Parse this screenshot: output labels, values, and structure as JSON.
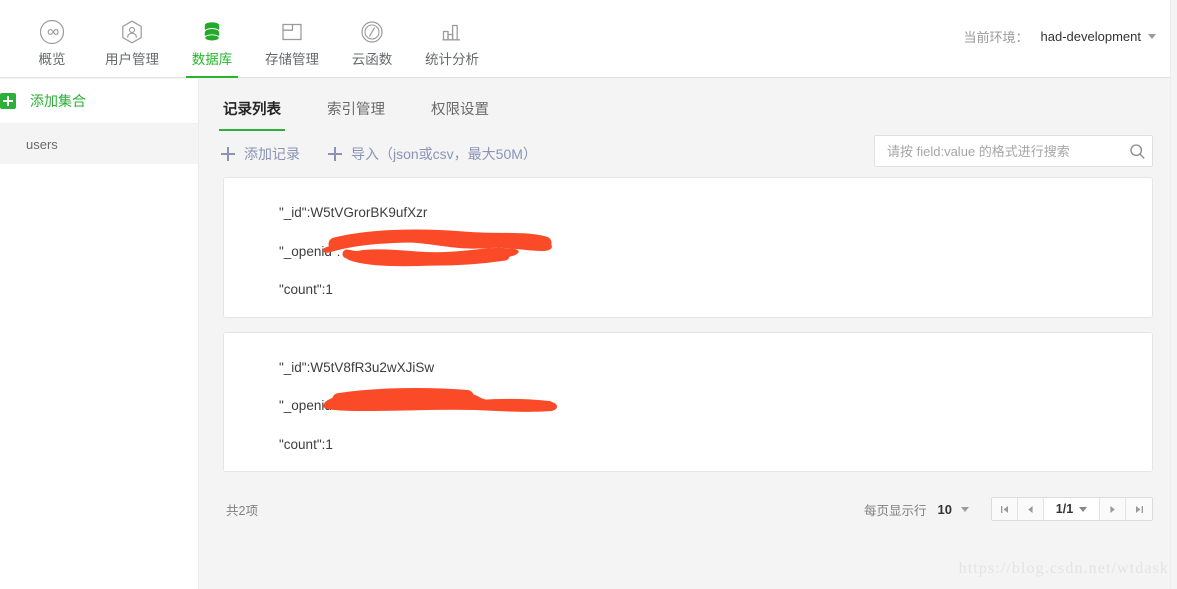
{
  "topnav": {
    "items": [
      {
        "label": "概览",
        "icon": "infinity-circle-icon",
        "active": false
      },
      {
        "label": "用户管理",
        "icon": "user-hexagon-icon",
        "active": false
      },
      {
        "label": "数据库",
        "icon": "database-icon",
        "active": true
      },
      {
        "label": "存储管理",
        "icon": "folder-icon",
        "active": false
      },
      {
        "label": "云函数",
        "icon": "slash-circle-icon",
        "active": false
      },
      {
        "label": "统计分析",
        "icon": "bar-chart-icon",
        "active": false
      }
    ],
    "env_label": "当前环境：",
    "env_value": "had-development",
    "env_caret": "chevron-down-icon"
  },
  "sidebar": {
    "add_collection_label": "添加集合",
    "add_collection_icon": "plus-square-icon",
    "collections": [
      {
        "name": "users",
        "selected": true
      }
    ]
  },
  "main": {
    "tabs": [
      {
        "label": "记录列表",
        "active": true
      },
      {
        "label": "索引管理",
        "active": false
      },
      {
        "label": "权限设置",
        "active": false
      }
    ],
    "toolbar": {
      "add_record_label": "添加记录",
      "import_label": "导入",
      "import_hint": "（json或csv，最大50M）",
      "plus_icon": "plus-icon"
    },
    "search": {
      "placeholder": "请按 field:value 的格式进行搜索",
      "value": "",
      "icon": "search-icon"
    },
    "records": [
      {
        "lines": [
          {
            "key": "\"_id\":",
            "value": "W5tVGrorBK9ufXzr",
            "redacted": false
          },
          {
            "key": "\"_openid\":",
            "value": "",
            "redacted": true,
            "scribble": "blob-loop"
          },
          {
            "key": "\"count\":",
            "value": "1",
            "redacted": false
          }
        ]
      },
      {
        "lines": [
          {
            "key": "\"_id\":",
            "value": "W5tV8fR3u2wXJiSw",
            "redacted": false
          },
          {
            "key": "\"_openid\":",
            "value": "",
            "redacted": true,
            "scribble": "blob-bar"
          },
          {
            "key": "\"count\":",
            "value": "1",
            "redacted": false
          }
        ]
      }
    ],
    "footer": {
      "total_text": "共2项",
      "rows_label": "每页显示行",
      "rows_value": "10",
      "page_value": "1/1",
      "first_icon": "first-page-icon",
      "prev_icon": "prev-page-icon",
      "next_icon": "next-page-icon",
      "last_icon": "last-page-icon"
    }
  },
  "watermark": "https://blog.csdn.net/wtdask",
  "colors": {
    "accent_green": "#2db039",
    "redaction_orange": "#fa4a28",
    "tool_blue": "#8a93b5",
    "page_bg": "#f4f4f4"
  }
}
